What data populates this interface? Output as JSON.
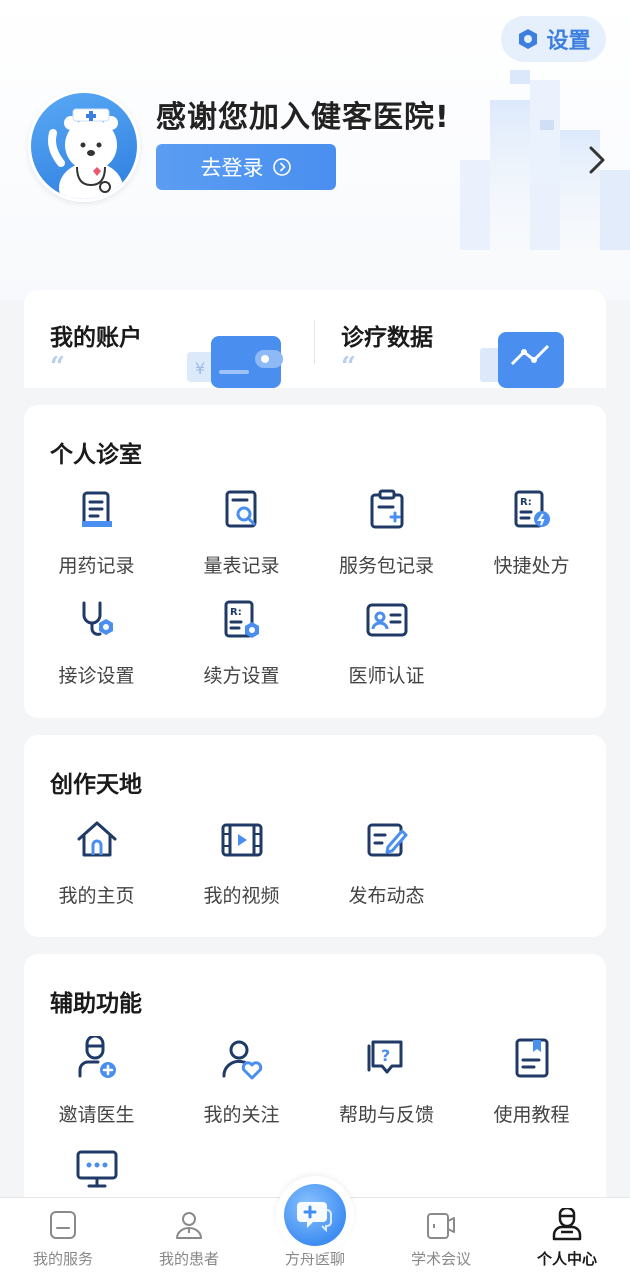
{
  "header": {
    "settings_label": "设置",
    "welcome_text": "感谢您加入健客医院!",
    "login_label": "去登录"
  },
  "summary": {
    "account_title": "我的账户",
    "diagnosis_title": "诊疗数据",
    "quote_glyph": "“"
  },
  "personal_clinic": {
    "title": "个人诊室",
    "items": [
      {
        "label": "用药记录",
        "icon": "medication-record-icon"
      },
      {
        "label": "量表记录",
        "icon": "scale-record-icon"
      },
      {
        "label": "服务包记录",
        "icon": "service-package-icon"
      },
      {
        "label": "快捷处方",
        "icon": "quick-prescription-icon"
      },
      {
        "label": "接诊设置",
        "icon": "stethoscope-settings-icon"
      },
      {
        "label": "续方设置",
        "icon": "renewal-settings-icon"
      },
      {
        "label": "医师认证",
        "icon": "doctor-certification-icon"
      }
    ]
  },
  "creation": {
    "title": "创作天地",
    "items": [
      {
        "label": "我的主页",
        "icon": "home-icon"
      },
      {
        "label": "我的视频",
        "icon": "video-icon"
      },
      {
        "label": "发布动态",
        "icon": "edit-post-icon"
      }
    ]
  },
  "assist": {
    "title": "辅助功能",
    "items": [
      {
        "label": "邀请医生",
        "icon": "invite-doctor-icon"
      },
      {
        "label": "我的关注",
        "icon": "follow-heart-icon"
      },
      {
        "label": "帮助与反馈",
        "icon": "help-feedback-icon"
      },
      {
        "label": "使用教程",
        "icon": "tutorial-book-icon"
      },
      {
        "label": "",
        "icon": "message-screen-icon"
      }
    ]
  },
  "tabbar": {
    "tabs": [
      {
        "label": "我的服务",
        "icon": "service-icon"
      },
      {
        "label": "我的患者",
        "icon": "patient-icon"
      },
      {
        "label": "方舟医聊",
        "icon": "chat-bubble-icon"
      },
      {
        "label": "学术会议",
        "icon": "meeting-video-icon"
      },
      {
        "label": "个人中心",
        "icon": "profile-icon"
      }
    ],
    "active_index": 4
  },
  "colors": {
    "accent": "#3d7fe0",
    "icon_stroke": "#1f3a66",
    "icon_accent": "#4a8ff0"
  }
}
